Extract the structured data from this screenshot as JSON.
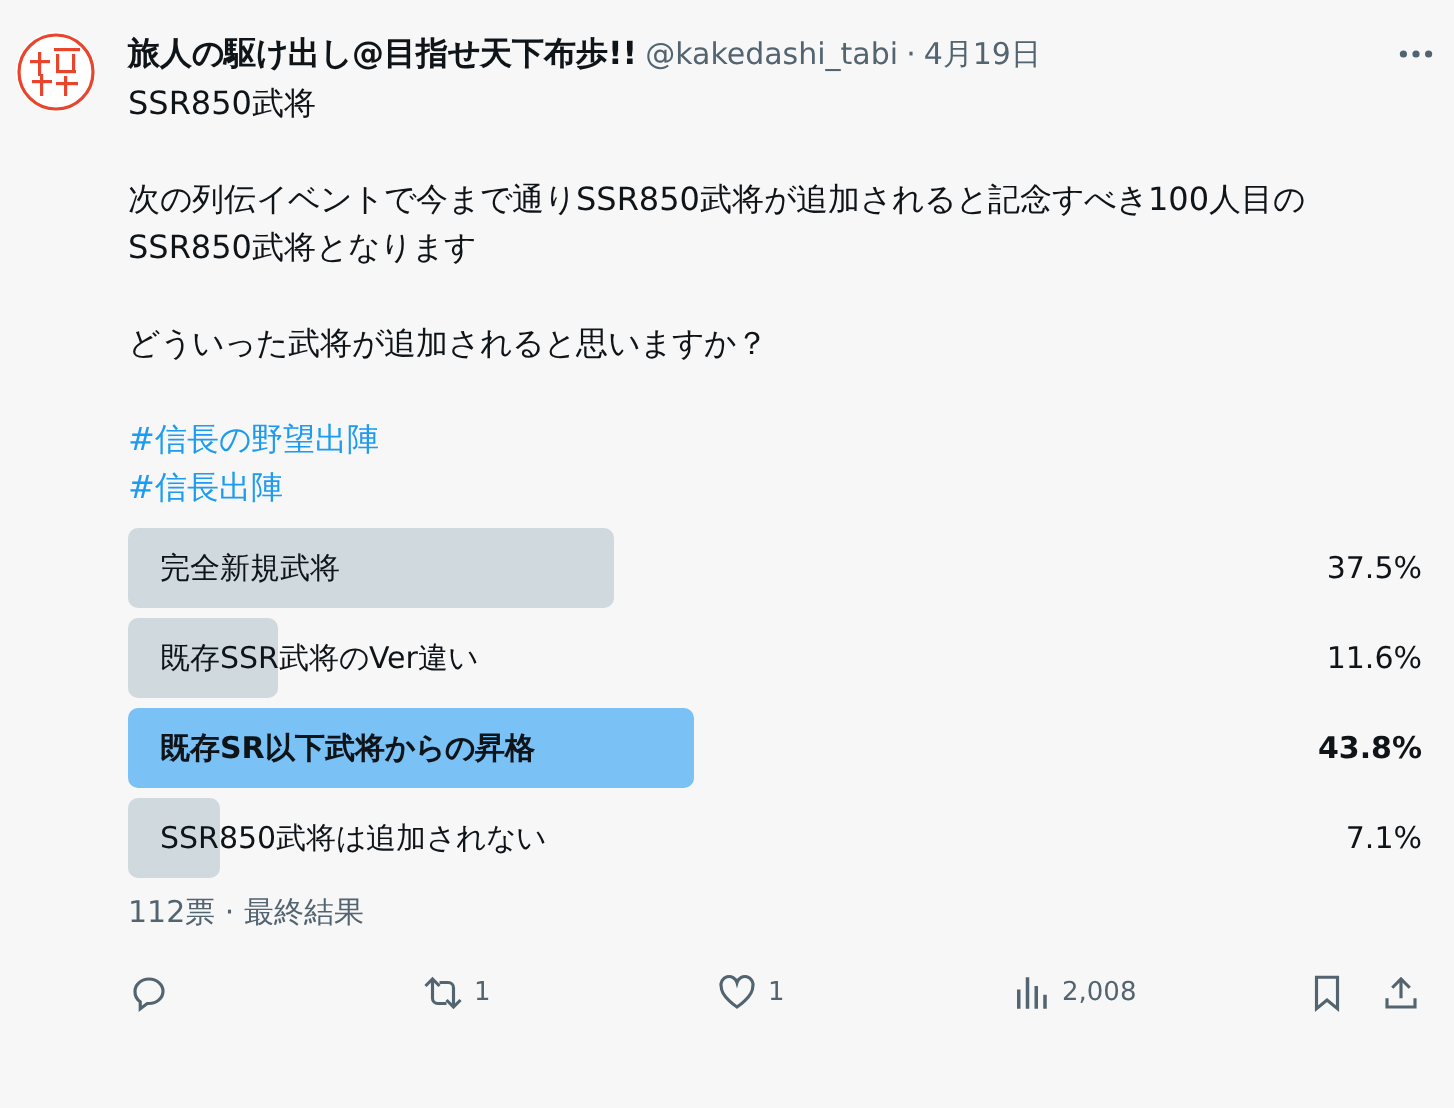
{
  "author": {
    "name": "旅人の駆け出し@目指せ天下布歩!!",
    "handle": "@kakedashi_tabi",
    "separator": "·",
    "date": "4月19日"
  },
  "tweet": {
    "paragraphs": [
      "SSR850武将",
      "次の列伝イベントで今まで通りSSR850武将が追加されると記念すべき100人目のSSR850武将となります",
      "どういった武将が追加されると思いますか？"
    ],
    "hashtags": [
      "#信長の野望出陣",
      "#信長出陣"
    ]
  },
  "poll": {
    "options": [
      {
        "label": "完全新規武将",
        "percent": "37.5%",
        "selected": false
      },
      {
        "label": "既存SSR武将のVer違い",
        "percent": "11.6%",
        "selected": false
      },
      {
        "label": "既存SR以下武将からの昇格",
        "percent": "43.8%",
        "selected": true
      },
      {
        "label": "SSR850武将は追加されない",
        "percent": "7.1%",
        "selected": false
      }
    ],
    "summary": "112票 · 最終結果"
  },
  "actions": [
    {
      "kind": "reply"
    },
    {
      "kind": "repost",
      "count": "1"
    },
    {
      "kind": "like",
      "count": "1"
    },
    {
      "kind": "views",
      "count": "2,008"
    }
  ]
}
